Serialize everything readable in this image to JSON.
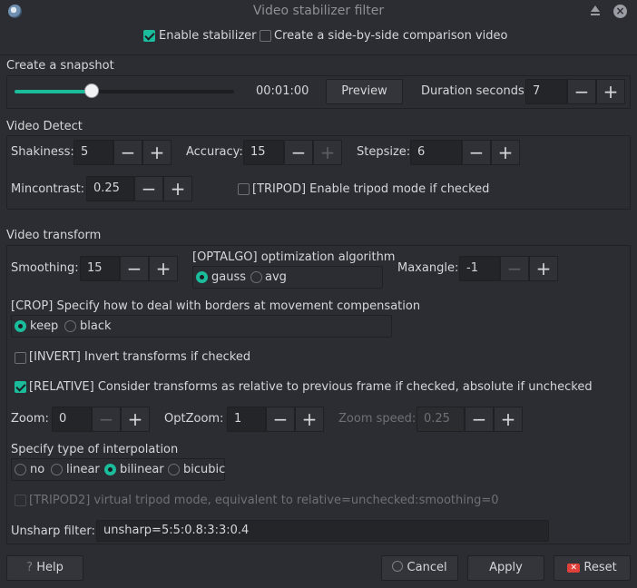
{
  "window": {
    "title": "Video stabilizer filter",
    "icons": [
      "app-logo-icon",
      "shade-icon",
      "close-icon"
    ]
  },
  "top": {
    "enable_stabilizer": {
      "label": "Enable stabilizer",
      "checked": true
    },
    "comparison": {
      "label": "Create a side-by-side comparison video",
      "checked": false
    }
  },
  "snapshot": {
    "heading": "Create a snapshot",
    "slider_fraction": 0.35,
    "time": "00:01:00",
    "preview_label": "Preview",
    "duration_label": "Duration seconds:",
    "duration_value": "7"
  },
  "detect": {
    "heading": "Video Detect",
    "shakiness_label": "Shakiness:",
    "shakiness_value": "5",
    "accuracy_label": "Accuracy:",
    "accuracy_value": "15",
    "stepsize_label": "Stepsize:",
    "stepsize_value": "6",
    "mincontrast_label": "Mincontrast:",
    "mincontrast_value": "0.25",
    "tripod": {
      "label": "[TRIPOD] Enable tripod mode if checked",
      "checked": false
    }
  },
  "transform": {
    "heading": "Video transform",
    "smoothing_label": "Smoothing:",
    "smoothing_value": "15",
    "optalgo": {
      "heading": "[OPTALGO] optimization algorithm",
      "options": [
        "gauss",
        "avg"
      ],
      "selected": "gauss"
    },
    "maxangle_label": "Maxangle:",
    "maxangle_value": "-1",
    "crop": {
      "heading": "[CROP] Specify how to deal with borders at movement compensation",
      "options": [
        "keep",
        "black"
      ],
      "selected": "keep"
    },
    "invert": {
      "label": "[INVERT] Invert transforms if checked",
      "checked": false
    },
    "relative": {
      "label": "[RELATIVE] Consider transforms as relative to previous frame if checked, absolute if unchecked",
      "checked": true
    },
    "zoom_label": "Zoom:",
    "zoom_value": "0",
    "optzoom_label": "OptZoom:",
    "optzoom_value": "1",
    "zoomspeed_label": "Zoom speed:",
    "zoomspeed_value": "0.25",
    "interp": {
      "heading": "Specify type of interpolation",
      "options": [
        "no",
        "linear",
        "bilinear",
        "bicubic"
      ],
      "selected": "bilinear"
    },
    "tripod2": {
      "label": "[TRIPOD2] virtual tripod mode, equivalent to relative=unchecked:smoothing=0",
      "checked": false
    },
    "unsharp_label": "Unsharp filter:",
    "unsharp_value": "unsharp=5:5:0.8:3:3:0.4"
  },
  "buttons": {
    "help": "Help",
    "cancel": "Cancel",
    "apply": "Apply",
    "reset": "Reset"
  },
  "colors": {
    "accent": "#1abc9c",
    "reset_icon": "#e0403a",
    "background": "#2b2d32"
  }
}
